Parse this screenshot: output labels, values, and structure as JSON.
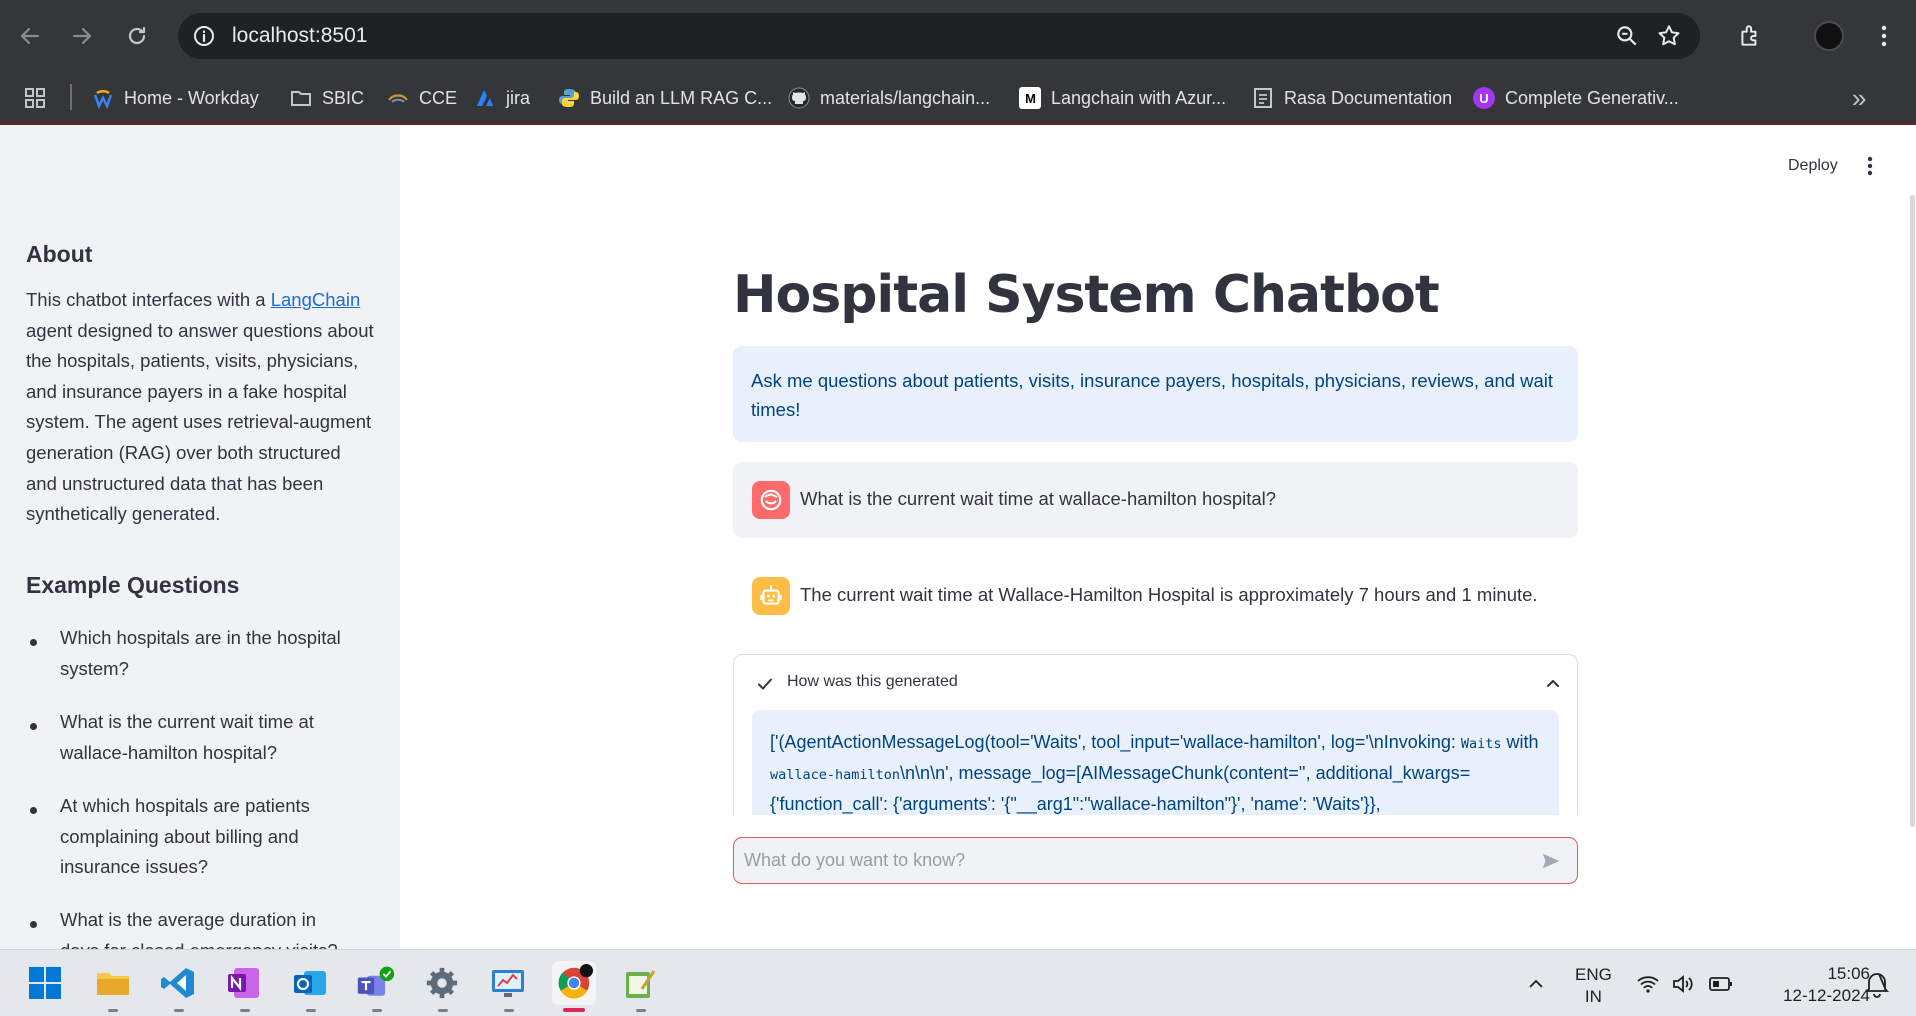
{
  "browser": {
    "url": "localhost:8501",
    "bookmarks": [
      {
        "label": "Home - Workday",
        "icon": "workday-icon"
      },
      {
        "label": "SBIC",
        "icon": "folder-icon"
      },
      {
        "label": "CCE",
        "icon": "cce-icon"
      },
      {
        "label": "jira",
        "icon": "jira-icon"
      },
      {
        "label": "Build an LLM RAG C...",
        "icon": "python-icon"
      },
      {
        "label": "materials/langchain...",
        "icon": "github-icon"
      },
      {
        "label": "Langchain with Azur...",
        "icon": "medium-icon"
      },
      {
        "label": "Rasa Documentation",
        "icon": "document-icon"
      },
      {
        "label": "Complete Generativ...",
        "icon": "udemy-icon"
      }
    ],
    "overflow": "»"
  },
  "sidebar": {
    "about_heading": "About",
    "about_pre": "This chatbot interfaces with a ",
    "about_link": "LangChain",
    "about_post": " agent designed to answer questions about the hospitals, patients, visits, physicians, and insurance payers in a fake hospital system. The agent uses retrieval-augment generation (RAG) over both structured and unstructured data that has been synthetically generated.",
    "examples_heading": "Example Questions",
    "questions": [
      "Which hospitals are in the hospital system?",
      "What is the current wait time at wallace-hamilton hospital?",
      "At which hospitals are patients complaining about billing and insurance issues?",
      "What is the average duration in days for closed emergency visits?"
    ]
  },
  "main": {
    "deploy_label": "Deploy",
    "title": "Hospital System Chatbot",
    "info": "Ask me questions about patients, visits, insurance payers, hospitals, physicians, reviews, and wait times!",
    "user_message": "What is the current wait time at wallace-hamilton hospital?",
    "assistant_message": "The current wait time at Wallace-Hamilton Hospital is approximately 7 hours and 1 minute.",
    "expander_label": "How was this generated",
    "log": {
      "p1": "['(AgentActionMessageLog(tool='Waits', tool_input='wallace-hamilton', log='\\nInvoking: ",
      "c1": "Waits",
      "p2": " with ",
      "c2": "wallace-hamilton",
      "p3": "\\n\\n\\n', message_log=[AIMessageChunk(content='', additional_kwargs={'function_call': {'arguments': '{\"__arg1\":\"wallace-hamilton\"}', 'name': 'Waits'}},"
    },
    "chat_placeholder": "What do you want to know?"
  },
  "taskbar": {
    "lang_line1": "ENG",
    "lang_line2": "IN",
    "time": "15:06",
    "date": "12-12-2024"
  },
  "colors": {
    "accent_red": "#ff4b4b",
    "assistant_orange": "#ffbd45",
    "info_bg": "#e8f1fb",
    "info_text": "#004280"
  }
}
